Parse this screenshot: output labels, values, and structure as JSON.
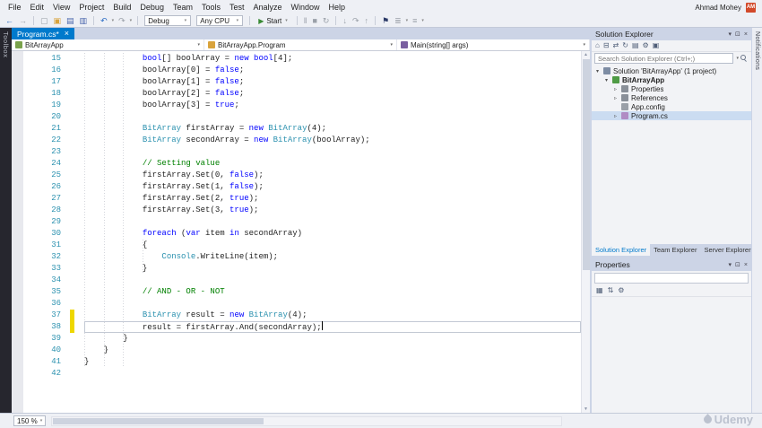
{
  "colors": {
    "accent": "#007acc",
    "keyword": "#0000ff",
    "type": "#2b91af",
    "comment": "#008000",
    "line_number": "#2b91af",
    "changed_mark": "#eed700",
    "start_green": "#388a34",
    "avatar_bg": "#d2492a"
  },
  "titlebar": {
    "user": "Ahmad Mohey",
    "avatar_initials": "AM"
  },
  "menu": {
    "items": [
      "File",
      "Edit",
      "View",
      "Project",
      "Build",
      "Debug",
      "Team",
      "Tools",
      "Test",
      "Analyze",
      "Window",
      "Help"
    ]
  },
  "toolbar": {
    "debug_target": "Debug",
    "platform": "Any CPU",
    "start_label": "Start",
    "icons_left": [
      {
        "name": "navigate-backward-icon",
        "glyph": "←",
        "color": "#2a6cc4"
      },
      {
        "name": "navigate-forward-icon",
        "glyph": "→",
        "color": "#9aa0a8"
      },
      {
        "name": "sep"
      },
      {
        "name": "new-file-icon",
        "glyph": "▢",
        "color": "#9aa0a8"
      },
      {
        "name": "open-file-icon",
        "glyph": "▣",
        "color": "#d9a33c"
      },
      {
        "name": "save-icon",
        "glyph": "▤",
        "color": "#4a66ac"
      },
      {
        "name": "save-all-icon",
        "glyph": "▥",
        "color": "#4a66ac"
      },
      {
        "name": "sep"
      },
      {
        "name": "undo-icon",
        "glyph": "↶",
        "color": "#2a6cc4",
        "caret": true
      },
      {
        "name": "redo-icon",
        "glyph": "↷",
        "color": "#9aa0a8",
        "caret": true
      },
      {
        "name": "sep"
      }
    ],
    "icons_right": [
      {
        "name": "sep"
      },
      {
        "name": "pause-icon",
        "glyph": "‖",
        "color": "#9aa0a8"
      },
      {
        "name": "stop-icon",
        "glyph": "■",
        "color": "#9aa0a8"
      },
      {
        "name": "restart-icon",
        "glyph": "↻",
        "color": "#9aa0a8"
      },
      {
        "name": "sep"
      },
      {
        "name": "step-into-icon",
        "glyph": "↓",
        "color": "#9aa0a8"
      },
      {
        "name": "step-over-icon",
        "glyph": "↷",
        "color": "#9aa0a8"
      },
      {
        "name": "step-out-icon",
        "glyph": "↑",
        "color": "#9aa0a8"
      },
      {
        "name": "sep"
      },
      {
        "name": "bookmark-icon",
        "glyph": "⚑",
        "color": "#2b3a67"
      },
      {
        "name": "comment-icon",
        "glyph": "≣",
        "color": "#9aa0a8",
        "caret": true
      },
      {
        "name": "indent-icon",
        "glyph": "≡",
        "color": "#9aa0a8",
        "caret": true
      }
    ]
  },
  "left_strip": {
    "label": "Toolbox"
  },
  "right_strip": {
    "label": "Notifications"
  },
  "tabs": [
    {
      "label": "Program.cs*",
      "active": true
    }
  ],
  "navbar": {
    "project": "BitArrayApp",
    "type": "BitArrayApp.Program",
    "member": "Main(string[] args)"
  },
  "editor": {
    "lines": [
      {
        "n": 15,
        "ind": 12,
        "seg": [
          [
            "bool",
            "k"
          ],
          [
            "[] boolArray = ",
            "p"
          ],
          [
            "new",
            "k"
          ],
          [
            " ",
            "p"
          ],
          [
            "bool",
            "k"
          ],
          [
            "[4];",
            "p"
          ]
        ]
      },
      {
        "n": 16,
        "ind": 12,
        "seg": [
          [
            "boolArray[0] = ",
            "p"
          ],
          [
            "false",
            "k"
          ],
          [
            ";",
            "p"
          ]
        ]
      },
      {
        "n": 17,
        "ind": 12,
        "seg": [
          [
            "boolArray[1] = ",
            "p"
          ],
          [
            "false",
            "k"
          ],
          [
            ";",
            "p"
          ]
        ]
      },
      {
        "n": 18,
        "ind": 12,
        "seg": [
          [
            "boolArray[2] = ",
            "p"
          ],
          [
            "false",
            "k"
          ],
          [
            ";",
            "p"
          ]
        ]
      },
      {
        "n": 19,
        "ind": 12,
        "seg": [
          [
            "boolArray[3] = ",
            "p"
          ],
          [
            "true",
            "k"
          ],
          [
            ";",
            "p"
          ]
        ]
      },
      {
        "n": 20,
        "ind": 0,
        "seg": []
      },
      {
        "n": 21,
        "ind": 12,
        "seg": [
          [
            "BitArray",
            "t"
          ],
          [
            " firstArray = ",
            "p"
          ],
          [
            "new",
            "k"
          ],
          [
            " ",
            "p"
          ],
          [
            "BitArray",
            "t"
          ],
          [
            "(4);",
            "p"
          ]
        ]
      },
      {
        "n": 22,
        "ind": 12,
        "seg": [
          [
            "BitArray",
            "t"
          ],
          [
            " secondArray = ",
            "p"
          ],
          [
            "new",
            "k"
          ],
          [
            " ",
            "p"
          ],
          [
            "BitArray",
            "t"
          ],
          [
            "(boolArray);",
            "p"
          ]
        ]
      },
      {
        "n": 23,
        "ind": 0,
        "seg": []
      },
      {
        "n": 24,
        "ind": 12,
        "seg": [
          [
            "// Setting value",
            "c"
          ]
        ]
      },
      {
        "n": 25,
        "ind": 12,
        "seg": [
          [
            "firstArray.Set(0, ",
            "p"
          ],
          [
            "false",
            "k"
          ],
          [
            ");",
            "p"
          ]
        ]
      },
      {
        "n": 26,
        "ind": 12,
        "seg": [
          [
            "firstArray.Set(1, ",
            "p"
          ],
          [
            "false",
            "k"
          ],
          [
            ");",
            "p"
          ]
        ]
      },
      {
        "n": 27,
        "ind": 12,
        "seg": [
          [
            "firstArray.Set(2, ",
            "p"
          ],
          [
            "true",
            "k"
          ],
          [
            ");",
            "p"
          ]
        ]
      },
      {
        "n": 28,
        "ind": 12,
        "seg": [
          [
            "firstArray.Set(3, ",
            "p"
          ],
          [
            "true",
            "k"
          ],
          [
            ");",
            "p"
          ]
        ]
      },
      {
        "n": 29,
        "ind": 0,
        "seg": []
      },
      {
        "n": 30,
        "ind": 12,
        "seg": [
          [
            "foreach",
            "k"
          ],
          [
            " (",
            "p"
          ],
          [
            "var",
            "k"
          ],
          [
            " item ",
            "p"
          ],
          [
            "in",
            "k"
          ],
          [
            " secondArray)",
            "p"
          ]
        ]
      },
      {
        "n": 31,
        "ind": 12,
        "seg": [
          [
            "{",
            "p"
          ]
        ]
      },
      {
        "n": 32,
        "ind": 16,
        "seg": [
          [
            "Console",
            "t"
          ],
          [
            ".WriteLine(item);",
            "p"
          ]
        ]
      },
      {
        "n": 33,
        "ind": 12,
        "seg": [
          [
            "}",
            "p"
          ]
        ]
      },
      {
        "n": 34,
        "ind": 0,
        "seg": []
      },
      {
        "n": 35,
        "ind": 12,
        "seg": [
          [
            "// AND - OR - NOT",
            "c"
          ]
        ]
      },
      {
        "n": 36,
        "ind": 0,
        "seg": []
      },
      {
        "n": 37,
        "ind": 12,
        "seg": [
          [
            "BitArray",
            "t"
          ],
          [
            " result = ",
            "p"
          ],
          [
            "new",
            "k"
          ],
          [
            " ",
            "p"
          ],
          [
            "BitArray",
            "t"
          ],
          [
            "(4);",
            "p"
          ]
        ],
        "changed": true
      },
      {
        "n": 38,
        "ind": 12,
        "seg": [
          [
            "result = firstArray.And(secondArray);",
            "p"
          ]
        ],
        "changed": true,
        "current": true,
        "caret": true
      },
      {
        "n": 39,
        "ind": 8,
        "seg": [
          [
            "}",
            "p"
          ]
        ]
      },
      {
        "n": 40,
        "ind": 4,
        "seg": [
          [
            "}",
            "p"
          ]
        ]
      },
      {
        "n": 41,
        "ind": 0,
        "seg": [
          [
            "}",
            "p"
          ]
        ]
      },
      {
        "n": 42,
        "ind": 0,
        "seg": []
      }
    ]
  },
  "solution_explorer": {
    "title": "Solution Explorer",
    "search_placeholder": "Search Solution Explorer (Ctrl+;)",
    "window_icons": [
      {
        "name": "window-position-icon",
        "glyph": "▾"
      },
      {
        "name": "pin-icon",
        "glyph": "⊡"
      },
      {
        "name": "close-icon",
        "glyph": "×"
      }
    ],
    "toolbar_icons": [
      {
        "name": "home-icon",
        "glyph": "⌂"
      },
      {
        "name": "collapse-all-icon",
        "glyph": "⊟"
      },
      {
        "name": "sync-with-active-document-icon",
        "glyph": "⇄"
      },
      {
        "name": "refresh-icon",
        "glyph": "↻"
      },
      {
        "name": "show-all-files-icon",
        "glyph": "▤"
      },
      {
        "name": "properties-window-icon",
        "glyph": "⚙"
      },
      {
        "name": "preview-selected-items-icon",
        "glyph": "▣"
      }
    ],
    "items": [
      {
        "label": "Solution 'BitArrayApp' (1 project)",
        "level": 0,
        "expand": "open",
        "icon": "solution",
        "icon_color": "#7d8ca3"
      },
      {
        "label": "BitArrayApp",
        "level": 1,
        "expand": "open",
        "icon": "csharp-project",
        "icon_color": "#4f9b45",
        "bold": true
      },
      {
        "label": "Properties",
        "level": 2,
        "expand": "closed",
        "icon": "properties",
        "icon_color": "#8a9099"
      },
      {
        "label": "References",
        "level": 2,
        "expand": "closed",
        "icon": "references",
        "icon_color": "#8a9099"
      },
      {
        "label": "App.config",
        "level": 2,
        "expand": "none",
        "icon": "config-file",
        "icon_color": "#9aa0a8"
      },
      {
        "label": "Program.cs",
        "level": 2,
        "expand": "closed",
        "icon": "csharp-file",
        "icon_color": "#b08cc4",
        "selected": true
      }
    ],
    "bottom_tabs": [
      {
        "label": "Solution Explorer",
        "active": true
      },
      {
        "label": "Team Explorer"
      },
      {
        "label": "Server Explorer"
      }
    ]
  },
  "properties": {
    "title": "Properties",
    "window_icons": [
      {
        "name": "window-position-icon",
        "glyph": "▾"
      },
      {
        "name": "pin-icon",
        "glyph": "⊡"
      },
      {
        "name": "close-icon",
        "glyph": "×"
      }
    ],
    "toolbar_icons": [
      {
        "name": "categorized-icon",
        "glyph": "▦"
      },
      {
        "name": "alphabetical-icon",
        "glyph": "⇅"
      },
      {
        "name": "property-pages-icon",
        "glyph": "⚙"
      }
    ]
  },
  "status": {
    "zoom": "150 %",
    "watermark": "Udemy"
  }
}
